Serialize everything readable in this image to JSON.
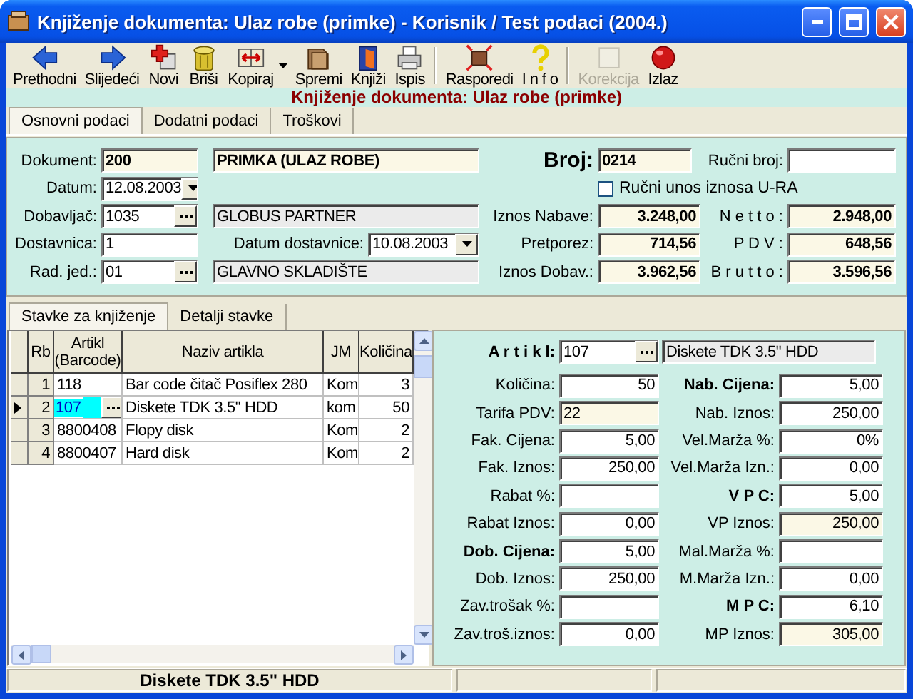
{
  "window": {
    "title": "Knjiženje dokumenta: Ulaz robe (primke) - Korisnik / Test podaci (2004.)"
  },
  "toolbar": [
    {
      "label": "Prethodni",
      "disabled": false,
      "dropdown": false
    },
    {
      "label": "Slijedeći",
      "disabled": false,
      "dropdown": false
    },
    {
      "label": "Novi",
      "disabled": false,
      "dropdown": false
    },
    {
      "label": "Briši",
      "disabled": false,
      "dropdown": false
    },
    {
      "label": "Kopiraj",
      "disabled": false,
      "dropdown": true
    },
    {
      "label": "Spremi",
      "disabled": false,
      "dropdown": false
    },
    {
      "label": "Knjiži",
      "disabled": false,
      "dropdown": false
    },
    {
      "label": "Ispis",
      "disabled": false,
      "dropdown": false
    },
    {
      "label": "Rasporedi",
      "disabled": false,
      "dropdown": false
    },
    {
      "label": "I n f o",
      "disabled": false,
      "dropdown": false
    },
    {
      "label": "Korekcija",
      "disabled": true,
      "dropdown": false
    },
    {
      "label": "Izlaz",
      "disabled": false,
      "dropdown": false
    }
  ],
  "header": "Knjiženje dokumenta: Ulaz robe (primke)",
  "tabs": [
    {
      "label": "Osnovni podaci",
      "selected": true
    },
    {
      "label": "Dodatni podaci",
      "selected": false
    },
    {
      "label": "Troškovi",
      "selected": false
    }
  ],
  "document": {
    "dokument": {
      "label": "Dokument:",
      "code": "200",
      "name": "PRIMKA (ULAZ ROBE)"
    },
    "broj": {
      "label": "Broj:",
      "value": "0214"
    },
    "rucni_broj": {
      "label": "Ručni broj:"
    },
    "datum": {
      "label": "Datum:",
      "value": "12.08.2003"
    },
    "manual_entry": {
      "label": "Ručni unos iznosa U-RA",
      "checked": false
    },
    "dobavljac": {
      "label": "Dobavljač:",
      "code": "1035",
      "name": "GLOBUS PARTNER"
    },
    "dostavnica": {
      "label": "Dostavnica:",
      "value": "1"
    },
    "datum_dostavnice": {
      "label": "Datum dostavnice:",
      "value": "10.08.2003"
    },
    "rad_jed": {
      "label": "Rad. jed.:",
      "code": "01",
      "name": "GLAVNO SKLADIŠTE"
    },
    "totals": [
      {
        "label": "Iznos Nabave:",
        "value": "3.248,00"
      },
      {
        "label": "Pretporez:",
        "value": "714,56"
      },
      {
        "label": "Iznos Dobav.:",
        "value": "3.962,56"
      }
    ],
    "summary": [
      {
        "label": "N e t t o :",
        "value": "2.948,00"
      },
      {
        "label": "P D V :",
        "value": "648,56"
      },
      {
        "label": "B r u t t o :",
        "value": "3.596,56"
      }
    ]
  },
  "item_tabs": [
    {
      "label": "Stavke za knjiženje",
      "selected": true
    },
    {
      "label": "Detalji stavke",
      "selected": false
    }
  ],
  "items": {
    "columns": [
      "Rb",
      "Artikl (Barcode)",
      "Naziv artikla",
      "JM",
      "Količina"
    ],
    "rows": [
      {
        "rb": "1",
        "artikl": "118",
        "naziv": "Bar code čitač Posiflex 280",
        "jm": "Kom",
        "kolicina": "3",
        "selected": false
      },
      {
        "rb": "2",
        "artikl": "107",
        "naziv": "Diskete TDK 3.5\" HDD",
        "jm": "kom",
        "kolicina": "50",
        "selected": true
      },
      {
        "rb": "3",
        "artikl": "8800408",
        "naziv": "Flopy disk",
        "jm": "Kom",
        "kolicina": "2",
        "selected": false
      },
      {
        "rb": "4",
        "artikl": "8800407",
        "naziv": "Hard disk",
        "jm": "Kom",
        "kolicina": "2",
        "selected": false
      }
    ]
  },
  "detail": {
    "article_label": "A r t i k l:",
    "article_code": "107",
    "article_name": "Diskete TDK 3.5\" HDD",
    "left": [
      {
        "label": "Količina:",
        "value": "50",
        "bold": false,
        "readonly": false,
        "kind": "number"
      },
      {
        "label": "Tarifa PDV:",
        "value": "22",
        "bold": false,
        "readonly": true,
        "kind": "code"
      },
      {
        "label": "Fak. Cijena:",
        "value": "5,00",
        "bold": false,
        "readonly": false,
        "kind": "number"
      },
      {
        "label": "Fak. Iznos:",
        "value": "250,00",
        "bold": false,
        "readonly": false,
        "kind": "number"
      },
      {
        "label": "Rabat %:",
        "bold": false,
        "readonly": false,
        "kind": "number"
      },
      {
        "label": "Rabat Iznos:",
        "value": "0,00",
        "bold": false,
        "readonly": false,
        "kind": "number"
      },
      {
        "label": "Dob. Cijena:",
        "value": "5,00",
        "bold": true,
        "readonly": false,
        "kind": "number"
      },
      {
        "label": "Dob. Iznos:",
        "value": "250,00",
        "bold": false,
        "readonly": false,
        "kind": "number"
      },
      {
        "label": "Zav.trošak %:",
        "bold": false,
        "readonly": false,
        "kind": "number"
      },
      {
        "label": "Zav.troš.iznos:",
        "value": "0,00",
        "bold": false,
        "readonly": false,
        "kind": "number"
      }
    ],
    "right": [
      {
        "label": "Nab. Cijena:",
        "value": "5,00",
        "bold": true,
        "readonly": false,
        "kind": "number"
      },
      {
        "label": "Nab. Iznos:",
        "value": "250,00",
        "bold": false,
        "readonly": false,
        "kind": "number"
      },
      {
        "label": "Vel.Marža %:",
        "value": "0%",
        "bold": false,
        "readonly": false,
        "kind": "number"
      },
      {
        "label": "Vel.Marža Izn.:",
        "value": "0,00",
        "bold": false,
        "readonly": false,
        "kind": "number"
      },
      {
        "label": "V P C:",
        "value": "5,00",
        "bold": true,
        "readonly": false,
        "kind": "number"
      },
      {
        "label": "VP Iznos:",
        "value": "250,00",
        "bold": false,
        "readonly": true,
        "kind": "number"
      },
      {
        "label": "Mal.Marža %:",
        "bold": false,
        "readonly": false,
        "kind": "number"
      },
      {
        "label": "M.Marža Izn.:",
        "value": "0,00",
        "bold": false,
        "readonly": false,
        "kind": "number"
      },
      {
        "label": "M P C:",
        "value": "6,10",
        "bold": true,
        "readonly": false,
        "kind": "number"
      },
      {
        "label": "MP Iznos:",
        "value": "305,00",
        "bold": false,
        "readonly": true,
        "kind": "number"
      }
    ]
  },
  "status_bar": {
    "text": "Diskete TDK 3.5\" HDD"
  }
}
